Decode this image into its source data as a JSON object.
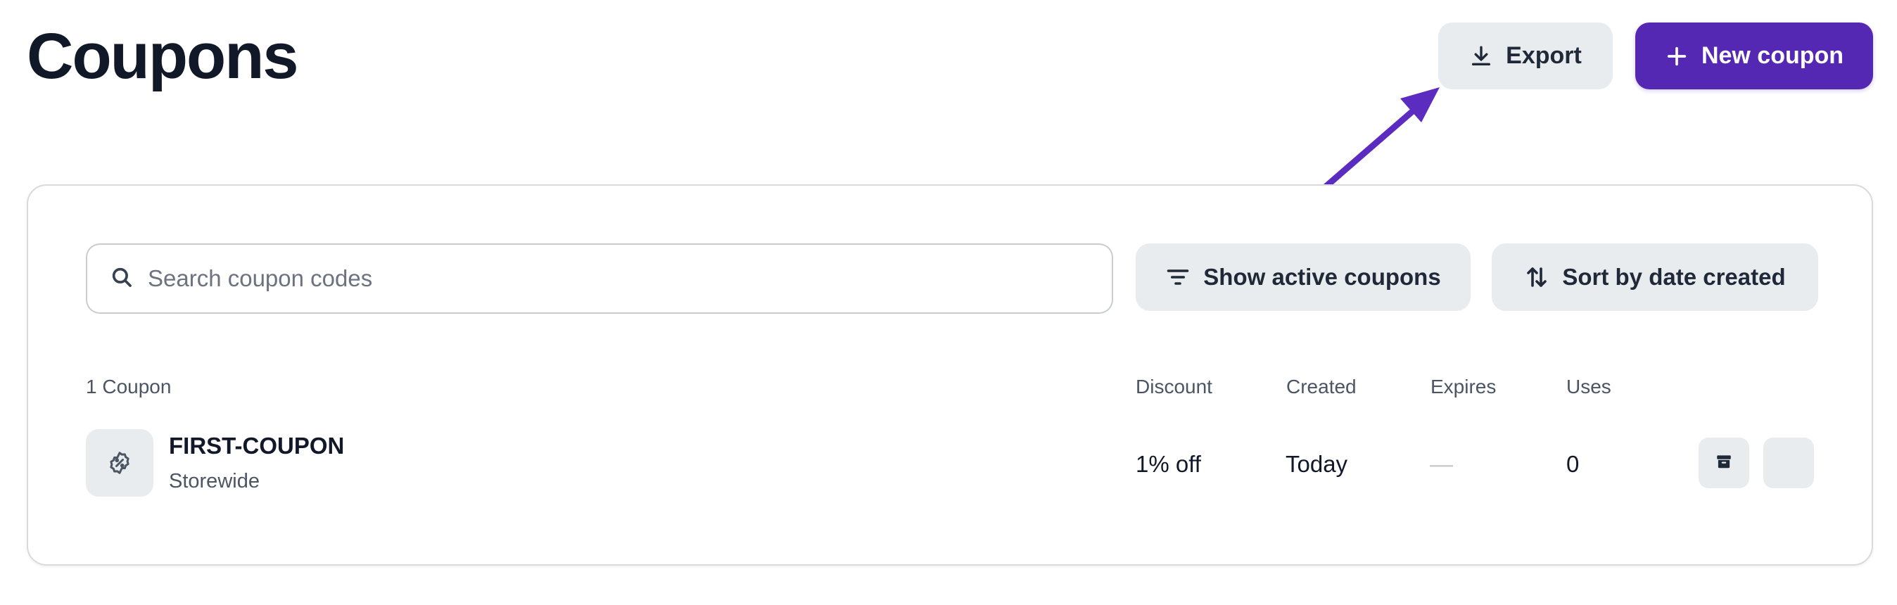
{
  "page": {
    "title": "Coupons"
  },
  "header": {
    "export_label": "Export",
    "new_coupon_label": "New coupon"
  },
  "toolbar": {
    "search_placeholder": "Search coupon codes",
    "search_value": "",
    "filter_label": "Show active coupons",
    "sort_label": "Sort by date created"
  },
  "table": {
    "count_label": "1 Coupon",
    "columns": {
      "discount": "Discount",
      "created": "Created",
      "expires": "Expires",
      "uses": "Uses"
    },
    "rows": [
      {
        "code": "FIRST-COUPON",
        "scope": "Storewide",
        "discount": "1% off",
        "created": "Today",
        "expires": "—",
        "uses": "0"
      }
    ]
  },
  "icons": {
    "export": "download-icon",
    "new_coupon": "plus-icon",
    "search": "search-icon",
    "filter": "filter-icon",
    "sort": "sort-icon",
    "coupon": "coupon-badge-icon",
    "archive": "archive-icon"
  },
  "colors": {
    "accent": "#5528b3",
    "button_gray": "#e9ecef",
    "annotation_arrow": "#5b2cbf"
  }
}
